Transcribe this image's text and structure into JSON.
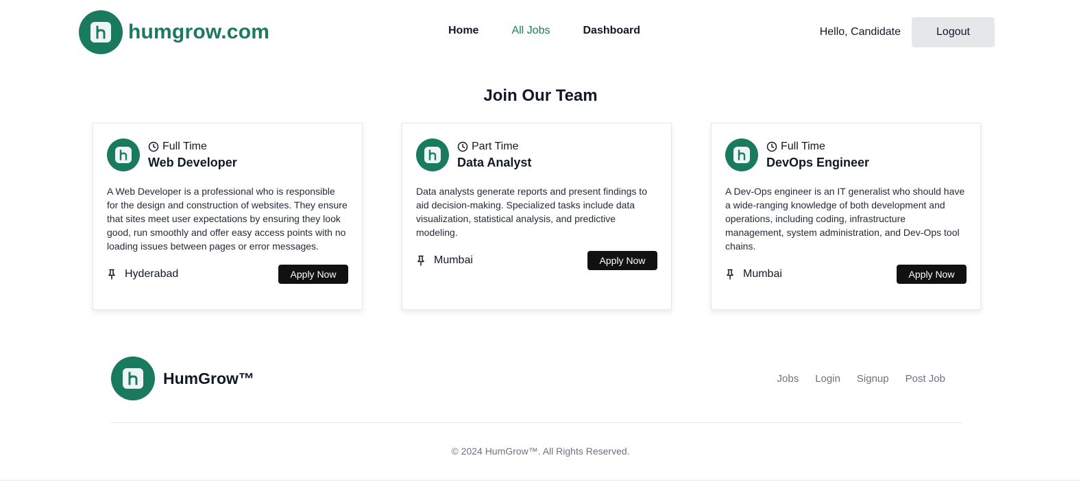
{
  "header": {
    "brand": "humgrow.com",
    "nav": [
      {
        "label": "Home",
        "active": false
      },
      {
        "label": "All Jobs",
        "active": true
      },
      {
        "label": "Dashboard",
        "active": false
      }
    ],
    "greeting": "Hello, Candidate",
    "logout_label": "Logout"
  },
  "main": {
    "title": "Join Our Team",
    "jobs": [
      {
        "type": "Full Time",
        "title": "Web Developer",
        "description": "A Web Developer is a professional who is responsible for the design and construction of websites. They ensure that sites meet user expectations by ensuring they look good, run smoothly and offer easy access points with no loading issues between pages or error messages.",
        "location": "Hyderabad",
        "apply_label": "Apply Now"
      },
      {
        "type": "Part Time",
        "title": "Data Analyst",
        "description": "Data analysts generate reports and present findings to aid decision-making. Specialized tasks include data visualization, statistical analysis, and predictive modeling.",
        "location": "Mumbai",
        "apply_label": "Apply Now"
      },
      {
        "type": "Full Time",
        "title": "DevOps Engineer",
        "description": "A Dev-Ops engineer is an IT generalist who should have a wide-ranging knowledge of both development and operations, including coding, infrastructure management, system administration, and Dev-Ops tool chains.",
        "location": "Mumbai",
        "apply_label": "Apply Now"
      }
    ]
  },
  "footer": {
    "brand": "HumGrow™",
    "links": [
      "Jobs",
      "Login",
      "Signup",
      "Post Job"
    ],
    "copyright": "© 2024 HumGrow™. All Rights Reserved."
  },
  "colors": {
    "brand": "#1a7a5e",
    "button_dark": "#111111",
    "logout_bg": "#e5e7eb"
  },
  "icons": {
    "logo": "humgrow-logo-icon",
    "job_type": "clock-icon",
    "location": "pushpin-icon"
  }
}
